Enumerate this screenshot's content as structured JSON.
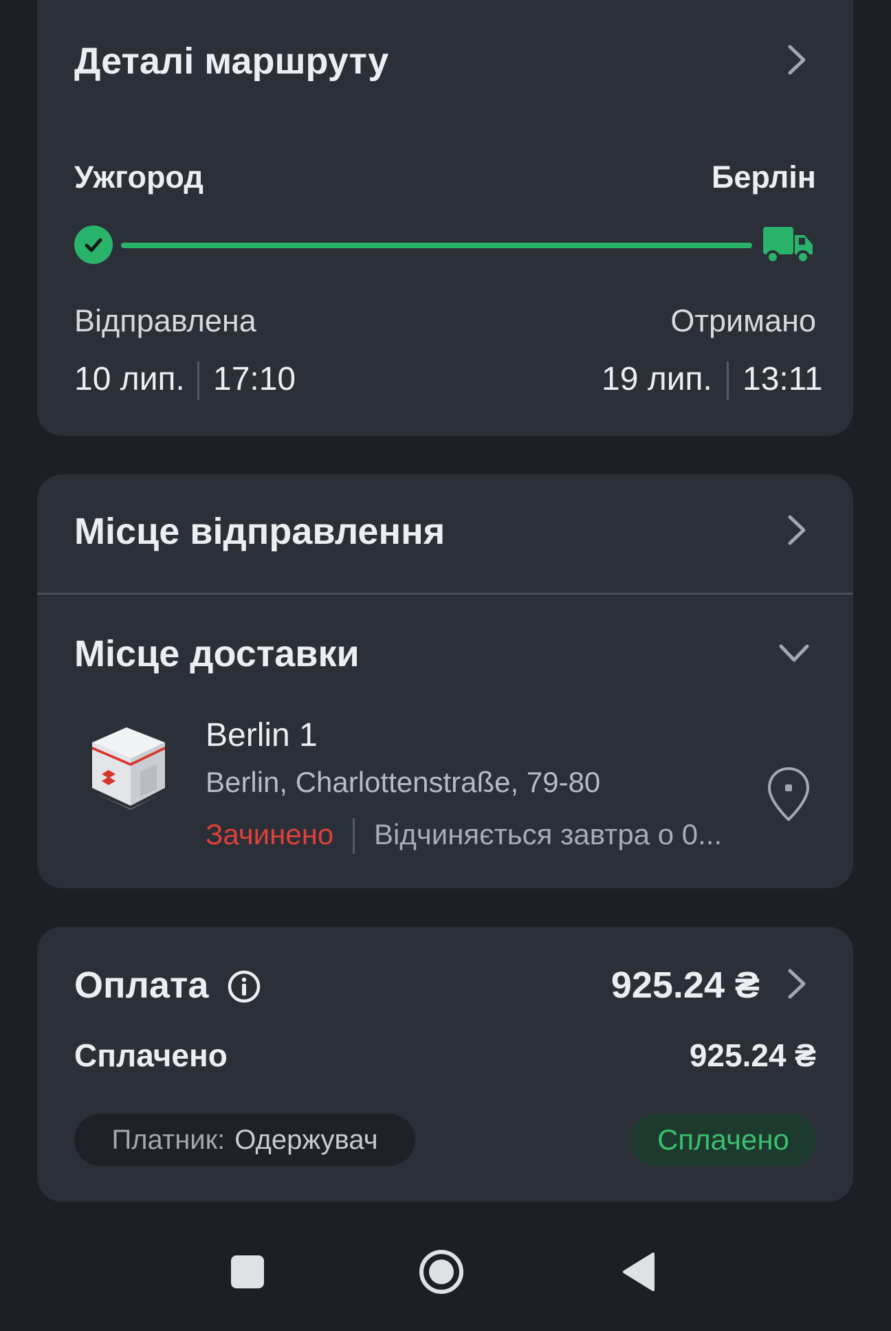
{
  "route": {
    "title": "Деталі маршруту",
    "from_city": "Ужгород",
    "to_city": "Берлін",
    "sent_label": "Відправлена",
    "received_label": "Отримано",
    "sent_date": "10 лип.",
    "sent_time": "17:10",
    "received_date": "19 лип.",
    "received_time": "13:11",
    "progress": 1.0,
    "accent_color": "#2ab36b"
  },
  "departure": {
    "title": "Місце відправлення"
  },
  "delivery": {
    "title": "Місце доставки",
    "branch_name": "Berlin 1",
    "address": "Berlin, Charlottenstraße, 79-80",
    "status_closed": "Зачинено",
    "opens_text": "Відчиняється завтра о 0..."
  },
  "payment": {
    "title": "Оплата",
    "total": "925.24 ₴",
    "paid_label": "Сплачено",
    "paid_amount": "925.24 ₴",
    "payer_label": "Платник:",
    "payer_value": "Одержувач",
    "status_badge": "Сплачено"
  },
  "icons": {
    "route_chevron": "chevron-right-icon",
    "check": "check-icon",
    "truck": "truck-icon",
    "map_pin": "map-pin-icon",
    "info": "info-icon"
  }
}
